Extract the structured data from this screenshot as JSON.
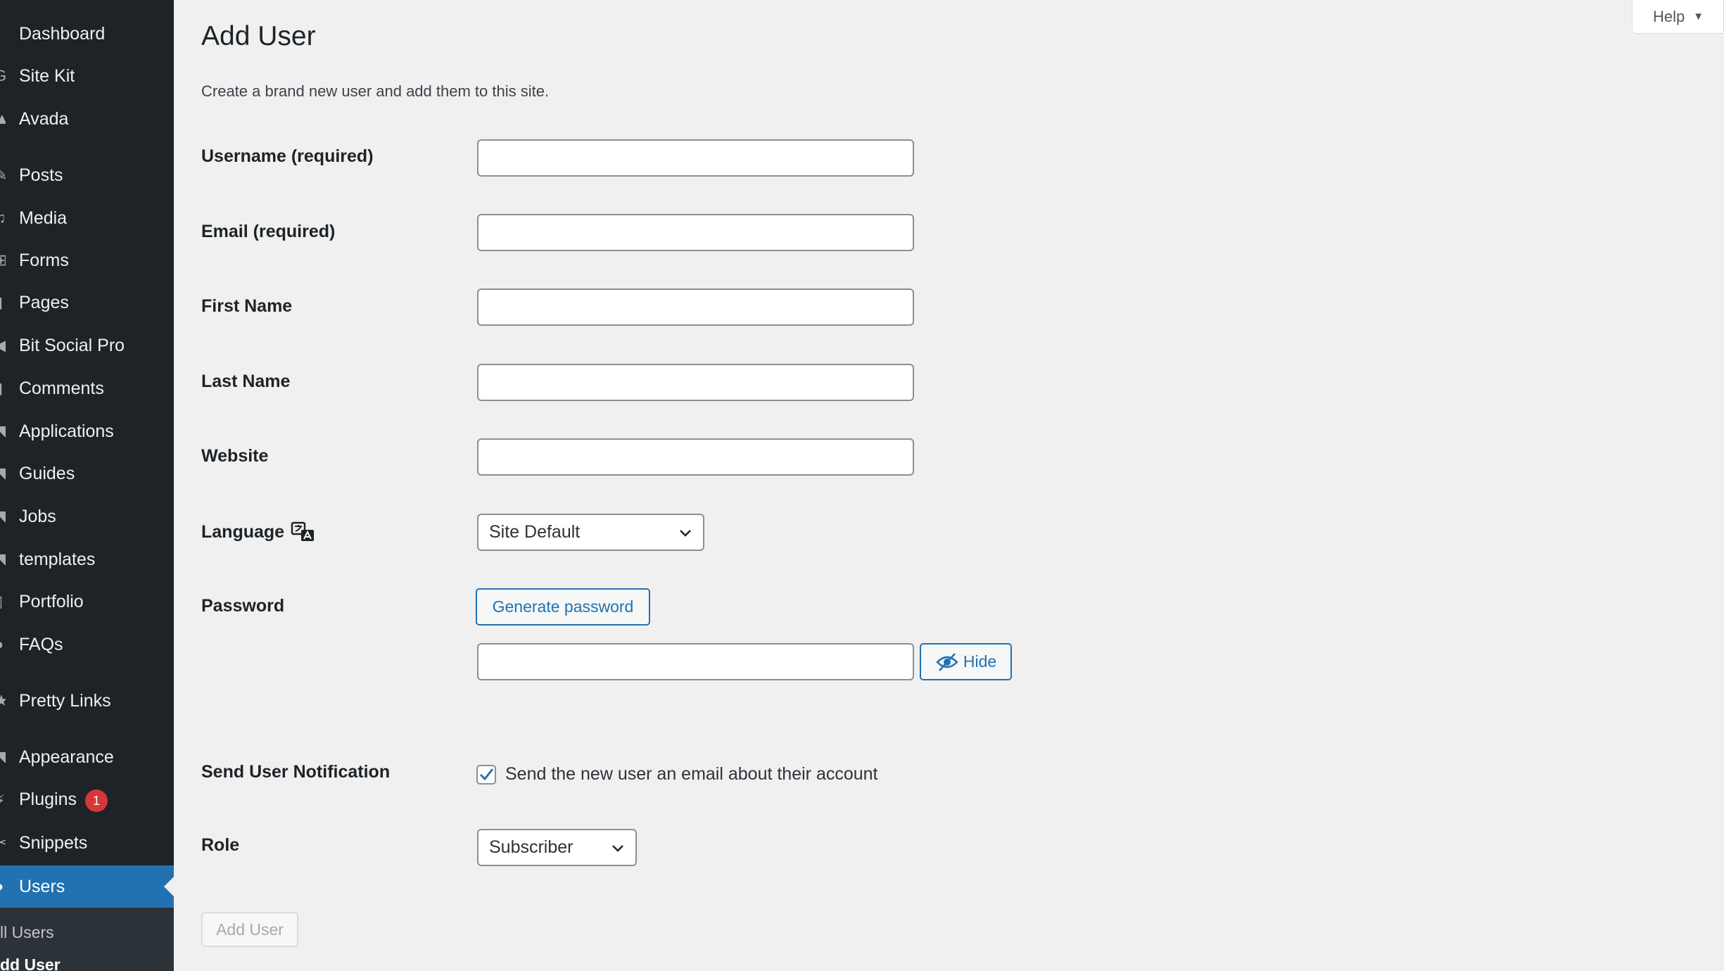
{
  "sidebar": {
    "items": [
      {
        "label": "Dashboard"
      },
      {
        "label": "Site Kit"
      },
      {
        "label": "Avada"
      },
      {
        "label": "Posts"
      },
      {
        "label": "Media"
      },
      {
        "label": "Forms"
      },
      {
        "label": "Pages"
      },
      {
        "label": "Bit Social Pro"
      },
      {
        "label": "Comments"
      },
      {
        "label": "Applications"
      },
      {
        "label": "Guides"
      },
      {
        "label": "Jobs"
      },
      {
        "label": "templates"
      },
      {
        "label": "Portfolio"
      },
      {
        "label": "FAQs"
      },
      {
        "label": "Pretty Links"
      },
      {
        "label": "Appearance"
      },
      {
        "label": "Plugins",
        "badge": "1"
      },
      {
        "label": "Snippets"
      },
      {
        "label": "Users"
      }
    ],
    "submenu": {
      "all_users": "ll Users",
      "add_user": "dd User"
    }
  },
  "help": {
    "label": "Help"
  },
  "page": {
    "title": "Add User",
    "description": "Create a brand new user and add them to this site."
  },
  "form": {
    "username_label": "Username (required)",
    "username_value": "",
    "email_label": "Email (required)",
    "email_value": "",
    "first_name_label": "First Name",
    "first_name_value": "",
    "last_name_label": "Last Name",
    "last_name_value": "",
    "website_label": "Website",
    "website_value": "",
    "language_label": "Language",
    "language_value": "Site Default",
    "password_label": "Password",
    "generate_password_label": "Generate password",
    "password_value": "",
    "hide_label": "Hide",
    "notification_label": "Send User Notification",
    "notification_checkbox_label": "Send the new user an email about their account",
    "notification_checked": true,
    "role_label": "Role",
    "role_value": "Subscriber",
    "submit_label": "Add User"
  },
  "colors": {
    "sidebar_bg": "#1d2327",
    "accent": "#2271b1",
    "badge": "#d63638",
    "page_bg": "#f0f0f1"
  }
}
